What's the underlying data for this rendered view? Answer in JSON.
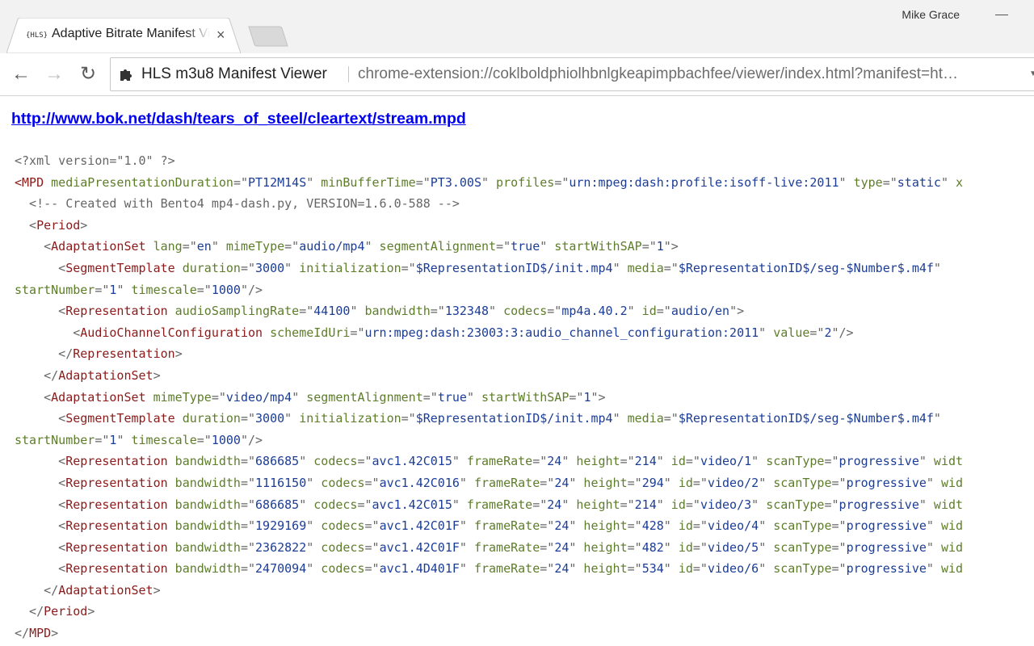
{
  "window": {
    "user_name": "Mike Grace"
  },
  "tab": {
    "favicon_text": "{HLS}",
    "title": "Adaptive Bitrate Manifest Viewer",
    "close_glyph": "×"
  },
  "toolbar": {
    "back_glyph": "←",
    "forward_glyph": "→",
    "reload_glyph": "↻",
    "extension_name": "HLS m3u8 Manifest Viewer",
    "url": "chrome-extension://coklboldphiolhbnlgkeapimpbachfee/viewer/index.html?manifest=ht…",
    "icons": [
      "back-arrow-icon",
      "forward-arrow-icon",
      "reload-icon",
      "puzzle-piece-icon",
      "dropdown-arrow-icon"
    ]
  },
  "page": {
    "manifest_url": "http://www.bok.net/dash/tears_of_steel/cleartext/stream.mpd"
  },
  "xml_lines": [
    [
      {
        "t": "c",
        "s": "<?xml version=\"1.0\" ?>"
      }
    ],
    [
      {
        "t": "t",
        "s": "<MPD"
      },
      {
        "t": "a",
        "s": " mediaPresentationDuration"
      },
      {
        "t": "p",
        "s": "=\""
      },
      {
        "t": "v",
        "s": "PT12M14S"
      },
      {
        "t": "p",
        "s": "\""
      },
      {
        "t": "a",
        "s": " minBufferTime"
      },
      {
        "t": "p",
        "s": "=\""
      },
      {
        "t": "v",
        "s": "PT3.00S"
      },
      {
        "t": "p",
        "s": "\""
      },
      {
        "t": "a",
        "s": " profiles"
      },
      {
        "t": "p",
        "s": "=\""
      },
      {
        "t": "v",
        "s": "urn:mpeg:dash:profile:isoff-live:2011"
      },
      {
        "t": "p",
        "s": "\""
      },
      {
        "t": "a",
        "s": " type"
      },
      {
        "t": "p",
        "s": "=\""
      },
      {
        "t": "v",
        "s": "static"
      },
      {
        "t": "p",
        "s": "\""
      },
      {
        "t": "a",
        "s": " x"
      }
    ],
    [
      {
        "t": "c",
        "s": "  <!-- Created with Bento4 mp4-dash.py, VERSION=1.6.0-588 -->"
      }
    ],
    [
      {
        "t": "p",
        "s": "  <"
      },
      {
        "t": "t",
        "s": "Period"
      },
      {
        "t": "p",
        "s": ">"
      }
    ],
    [
      {
        "t": "p",
        "s": "    <"
      },
      {
        "t": "t",
        "s": "AdaptationSet"
      },
      {
        "t": "a",
        "s": " lang"
      },
      {
        "t": "p",
        "s": "=\""
      },
      {
        "t": "v",
        "s": "en"
      },
      {
        "t": "p",
        "s": "\""
      },
      {
        "t": "a",
        "s": " mimeType"
      },
      {
        "t": "p",
        "s": "=\""
      },
      {
        "t": "v",
        "s": "audio/mp4"
      },
      {
        "t": "p",
        "s": "\""
      },
      {
        "t": "a",
        "s": " segmentAlignment"
      },
      {
        "t": "p",
        "s": "=\""
      },
      {
        "t": "v",
        "s": "true"
      },
      {
        "t": "p",
        "s": "\""
      },
      {
        "t": "a",
        "s": " startWithSAP"
      },
      {
        "t": "p",
        "s": "=\""
      },
      {
        "t": "v",
        "s": "1"
      },
      {
        "t": "p",
        "s": "\">"
      }
    ],
    [
      {
        "t": "p",
        "s": "      <"
      },
      {
        "t": "t",
        "s": "SegmentTemplate"
      },
      {
        "t": "a",
        "s": " duration"
      },
      {
        "t": "p",
        "s": "=\""
      },
      {
        "t": "v",
        "s": "3000"
      },
      {
        "t": "p",
        "s": "\""
      },
      {
        "t": "a",
        "s": " initialization"
      },
      {
        "t": "p",
        "s": "=\""
      },
      {
        "t": "v",
        "s": "$RepresentationID$/init.mp4"
      },
      {
        "t": "p",
        "s": "\""
      },
      {
        "t": "a",
        "s": " media"
      },
      {
        "t": "p",
        "s": "=\""
      },
      {
        "t": "v",
        "s": "$RepresentationID$/seg-$Number$.m4f"
      },
      {
        "t": "p",
        "s": "\""
      }
    ],
    [
      {
        "t": "a",
        "s": "startNumber"
      },
      {
        "t": "p",
        "s": "=\""
      },
      {
        "t": "v",
        "s": "1"
      },
      {
        "t": "p",
        "s": "\""
      },
      {
        "t": "a",
        "s": " timescale"
      },
      {
        "t": "p",
        "s": "=\""
      },
      {
        "t": "v",
        "s": "1000"
      },
      {
        "t": "p",
        "s": "\"/>"
      }
    ],
    [
      {
        "t": "p",
        "s": "      <"
      },
      {
        "t": "t",
        "s": "Representation"
      },
      {
        "t": "a",
        "s": " audioSamplingRate"
      },
      {
        "t": "p",
        "s": "=\""
      },
      {
        "t": "v",
        "s": "44100"
      },
      {
        "t": "p",
        "s": "\""
      },
      {
        "t": "a",
        "s": " bandwidth"
      },
      {
        "t": "p",
        "s": "=\""
      },
      {
        "t": "v",
        "s": "132348"
      },
      {
        "t": "p",
        "s": "\""
      },
      {
        "t": "a",
        "s": " codecs"
      },
      {
        "t": "p",
        "s": "=\""
      },
      {
        "t": "v",
        "s": "mp4a.40.2"
      },
      {
        "t": "p",
        "s": "\""
      },
      {
        "t": "a",
        "s": " id"
      },
      {
        "t": "p",
        "s": "=\""
      },
      {
        "t": "v",
        "s": "audio/en"
      },
      {
        "t": "p",
        "s": "\">"
      }
    ],
    [
      {
        "t": "p",
        "s": "        <"
      },
      {
        "t": "t",
        "s": "AudioChannelConfiguration"
      },
      {
        "t": "a",
        "s": " schemeIdUri"
      },
      {
        "t": "p",
        "s": "=\""
      },
      {
        "t": "v",
        "s": "urn:mpeg:dash:23003:3:audio_channel_configuration:2011"
      },
      {
        "t": "p",
        "s": "\""
      },
      {
        "t": "a",
        "s": " value"
      },
      {
        "t": "p",
        "s": "=\""
      },
      {
        "t": "v",
        "s": "2"
      },
      {
        "t": "p",
        "s": "\"/>"
      }
    ],
    [
      {
        "t": "p",
        "s": "      </"
      },
      {
        "t": "t",
        "s": "Representation"
      },
      {
        "t": "p",
        "s": ">"
      }
    ],
    [
      {
        "t": "p",
        "s": "    </"
      },
      {
        "t": "t",
        "s": "AdaptationSet"
      },
      {
        "t": "p",
        "s": ">"
      }
    ],
    [
      {
        "t": "p",
        "s": "    <"
      },
      {
        "t": "t",
        "s": "AdaptationSet"
      },
      {
        "t": "a",
        "s": " mimeType"
      },
      {
        "t": "p",
        "s": "=\""
      },
      {
        "t": "v",
        "s": "video/mp4"
      },
      {
        "t": "p",
        "s": "\""
      },
      {
        "t": "a",
        "s": " segmentAlignment"
      },
      {
        "t": "p",
        "s": "=\""
      },
      {
        "t": "v",
        "s": "true"
      },
      {
        "t": "p",
        "s": "\""
      },
      {
        "t": "a",
        "s": " startWithSAP"
      },
      {
        "t": "p",
        "s": "=\""
      },
      {
        "t": "v",
        "s": "1"
      },
      {
        "t": "p",
        "s": "\">"
      }
    ],
    [
      {
        "t": "p",
        "s": "      <"
      },
      {
        "t": "t",
        "s": "SegmentTemplate"
      },
      {
        "t": "a",
        "s": " duration"
      },
      {
        "t": "p",
        "s": "=\""
      },
      {
        "t": "v",
        "s": "3000"
      },
      {
        "t": "p",
        "s": "\""
      },
      {
        "t": "a",
        "s": " initialization"
      },
      {
        "t": "p",
        "s": "=\""
      },
      {
        "t": "v",
        "s": "$RepresentationID$/init.mp4"
      },
      {
        "t": "p",
        "s": "\""
      },
      {
        "t": "a",
        "s": " media"
      },
      {
        "t": "p",
        "s": "=\""
      },
      {
        "t": "v",
        "s": "$RepresentationID$/seg-$Number$.m4f"
      },
      {
        "t": "p",
        "s": "\""
      }
    ],
    [
      {
        "t": "a",
        "s": "startNumber"
      },
      {
        "t": "p",
        "s": "=\""
      },
      {
        "t": "v",
        "s": "1"
      },
      {
        "t": "p",
        "s": "\""
      },
      {
        "t": "a",
        "s": " timescale"
      },
      {
        "t": "p",
        "s": "=\""
      },
      {
        "t": "v",
        "s": "1000"
      },
      {
        "t": "p",
        "s": "\"/>"
      }
    ],
    [
      {
        "t": "p",
        "s": "      <"
      },
      {
        "t": "t",
        "s": "Representation"
      },
      {
        "t": "a",
        "s": " bandwidth"
      },
      {
        "t": "p",
        "s": "=\""
      },
      {
        "t": "v",
        "s": "686685"
      },
      {
        "t": "p",
        "s": "\""
      },
      {
        "t": "a",
        "s": " codecs"
      },
      {
        "t": "p",
        "s": "=\""
      },
      {
        "t": "v",
        "s": "avc1.42C015"
      },
      {
        "t": "p",
        "s": "\""
      },
      {
        "t": "a",
        "s": " frameRate"
      },
      {
        "t": "p",
        "s": "=\""
      },
      {
        "t": "v",
        "s": "24"
      },
      {
        "t": "p",
        "s": "\""
      },
      {
        "t": "a",
        "s": " height"
      },
      {
        "t": "p",
        "s": "=\""
      },
      {
        "t": "v",
        "s": "214"
      },
      {
        "t": "p",
        "s": "\""
      },
      {
        "t": "a",
        "s": " id"
      },
      {
        "t": "p",
        "s": "=\""
      },
      {
        "t": "v",
        "s": "video/1"
      },
      {
        "t": "p",
        "s": "\""
      },
      {
        "t": "a",
        "s": " scanType"
      },
      {
        "t": "p",
        "s": "=\""
      },
      {
        "t": "v",
        "s": "progressive"
      },
      {
        "t": "p",
        "s": "\""
      },
      {
        "t": "a",
        "s": " widt"
      }
    ],
    [
      {
        "t": "p",
        "s": "      <"
      },
      {
        "t": "t",
        "s": "Representation"
      },
      {
        "t": "a",
        "s": " bandwidth"
      },
      {
        "t": "p",
        "s": "=\""
      },
      {
        "t": "v",
        "s": "1116150"
      },
      {
        "t": "p",
        "s": "\""
      },
      {
        "t": "a",
        "s": " codecs"
      },
      {
        "t": "p",
        "s": "=\""
      },
      {
        "t": "v",
        "s": "avc1.42C016"
      },
      {
        "t": "p",
        "s": "\""
      },
      {
        "t": "a",
        "s": " frameRate"
      },
      {
        "t": "p",
        "s": "=\""
      },
      {
        "t": "v",
        "s": "24"
      },
      {
        "t": "p",
        "s": "\""
      },
      {
        "t": "a",
        "s": " height"
      },
      {
        "t": "p",
        "s": "=\""
      },
      {
        "t": "v",
        "s": "294"
      },
      {
        "t": "p",
        "s": "\""
      },
      {
        "t": "a",
        "s": " id"
      },
      {
        "t": "p",
        "s": "=\""
      },
      {
        "t": "v",
        "s": "video/2"
      },
      {
        "t": "p",
        "s": "\""
      },
      {
        "t": "a",
        "s": " scanType"
      },
      {
        "t": "p",
        "s": "=\""
      },
      {
        "t": "v",
        "s": "progressive"
      },
      {
        "t": "p",
        "s": "\""
      },
      {
        "t": "a",
        "s": " wid"
      }
    ],
    [
      {
        "t": "p",
        "s": "      <"
      },
      {
        "t": "t",
        "s": "Representation"
      },
      {
        "t": "a",
        "s": " bandwidth"
      },
      {
        "t": "p",
        "s": "=\""
      },
      {
        "t": "v",
        "s": "686685"
      },
      {
        "t": "p",
        "s": "\""
      },
      {
        "t": "a",
        "s": " codecs"
      },
      {
        "t": "p",
        "s": "=\""
      },
      {
        "t": "v",
        "s": "avc1.42C015"
      },
      {
        "t": "p",
        "s": "\""
      },
      {
        "t": "a",
        "s": " frameRate"
      },
      {
        "t": "p",
        "s": "=\""
      },
      {
        "t": "v",
        "s": "24"
      },
      {
        "t": "p",
        "s": "\""
      },
      {
        "t": "a",
        "s": " height"
      },
      {
        "t": "p",
        "s": "=\""
      },
      {
        "t": "v",
        "s": "214"
      },
      {
        "t": "p",
        "s": "\""
      },
      {
        "t": "a",
        "s": " id"
      },
      {
        "t": "p",
        "s": "=\""
      },
      {
        "t": "v",
        "s": "video/3"
      },
      {
        "t": "p",
        "s": "\""
      },
      {
        "t": "a",
        "s": " scanType"
      },
      {
        "t": "p",
        "s": "=\""
      },
      {
        "t": "v",
        "s": "progressive"
      },
      {
        "t": "p",
        "s": "\""
      },
      {
        "t": "a",
        "s": " widt"
      }
    ],
    [
      {
        "t": "p",
        "s": "      <"
      },
      {
        "t": "t",
        "s": "Representation"
      },
      {
        "t": "a",
        "s": " bandwidth"
      },
      {
        "t": "p",
        "s": "=\""
      },
      {
        "t": "v",
        "s": "1929169"
      },
      {
        "t": "p",
        "s": "\""
      },
      {
        "t": "a",
        "s": " codecs"
      },
      {
        "t": "p",
        "s": "=\""
      },
      {
        "t": "v",
        "s": "avc1.42C01F"
      },
      {
        "t": "p",
        "s": "\""
      },
      {
        "t": "a",
        "s": " frameRate"
      },
      {
        "t": "p",
        "s": "=\""
      },
      {
        "t": "v",
        "s": "24"
      },
      {
        "t": "p",
        "s": "\""
      },
      {
        "t": "a",
        "s": " height"
      },
      {
        "t": "p",
        "s": "=\""
      },
      {
        "t": "v",
        "s": "428"
      },
      {
        "t": "p",
        "s": "\""
      },
      {
        "t": "a",
        "s": " id"
      },
      {
        "t": "p",
        "s": "=\""
      },
      {
        "t": "v",
        "s": "video/4"
      },
      {
        "t": "p",
        "s": "\""
      },
      {
        "t": "a",
        "s": " scanType"
      },
      {
        "t": "p",
        "s": "=\""
      },
      {
        "t": "v",
        "s": "progressive"
      },
      {
        "t": "p",
        "s": "\""
      },
      {
        "t": "a",
        "s": " wid"
      }
    ],
    [
      {
        "t": "p",
        "s": "      <"
      },
      {
        "t": "t",
        "s": "Representation"
      },
      {
        "t": "a",
        "s": " bandwidth"
      },
      {
        "t": "p",
        "s": "=\""
      },
      {
        "t": "v",
        "s": "2362822"
      },
      {
        "t": "p",
        "s": "\""
      },
      {
        "t": "a",
        "s": " codecs"
      },
      {
        "t": "p",
        "s": "=\""
      },
      {
        "t": "v",
        "s": "avc1.42C01F"
      },
      {
        "t": "p",
        "s": "\""
      },
      {
        "t": "a",
        "s": " frameRate"
      },
      {
        "t": "p",
        "s": "=\""
      },
      {
        "t": "v",
        "s": "24"
      },
      {
        "t": "p",
        "s": "\""
      },
      {
        "t": "a",
        "s": " height"
      },
      {
        "t": "p",
        "s": "=\""
      },
      {
        "t": "v",
        "s": "482"
      },
      {
        "t": "p",
        "s": "\""
      },
      {
        "t": "a",
        "s": " id"
      },
      {
        "t": "p",
        "s": "=\""
      },
      {
        "t": "v",
        "s": "video/5"
      },
      {
        "t": "p",
        "s": "\""
      },
      {
        "t": "a",
        "s": " scanType"
      },
      {
        "t": "p",
        "s": "=\""
      },
      {
        "t": "v",
        "s": "progressive"
      },
      {
        "t": "p",
        "s": "\""
      },
      {
        "t": "a",
        "s": " wid"
      }
    ],
    [
      {
        "t": "p",
        "s": "      <"
      },
      {
        "t": "t",
        "s": "Representation"
      },
      {
        "t": "a",
        "s": " bandwidth"
      },
      {
        "t": "p",
        "s": "=\""
      },
      {
        "t": "v",
        "s": "2470094"
      },
      {
        "t": "p",
        "s": "\""
      },
      {
        "t": "a",
        "s": " codecs"
      },
      {
        "t": "p",
        "s": "=\""
      },
      {
        "t": "v",
        "s": "avc1.4D401F"
      },
      {
        "t": "p",
        "s": "\""
      },
      {
        "t": "a",
        "s": " frameRate"
      },
      {
        "t": "p",
        "s": "=\""
      },
      {
        "t": "v",
        "s": "24"
      },
      {
        "t": "p",
        "s": "\""
      },
      {
        "t": "a",
        "s": " height"
      },
      {
        "t": "p",
        "s": "=\""
      },
      {
        "t": "v",
        "s": "534"
      },
      {
        "t": "p",
        "s": "\""
      },
      {
        "t": "a",
        "s": " id"
      },
      {
        "t": "p",
        "s": "=\""
      },
      {
        "t": "v",
        "s": "video/6"
      },
      {
        "t": "p",
        "s": "\""
      },
      {
        "t": "a",
        "s": " scanType"
      },
      {
        "t": "p",
        "s": "=\""
      },
      {
        "t": "v",
        "s": "progressive"
      },
      {
        "t": "p",
        "s": "\""
      },
      {
        "t": "a",
        "s": " wid"
      }
    ],
    [
      {
        "t": "p",
        "s": "    </"
      },
      {
        "t": "t",
        "s": "AdaptationSet"
      },
      {
        "t": "p",
        "s": ">"
      }
    ],
    [
      {
        "t": "p",
        "s": "  </"
      },
      {
        "t": "t",
        "s": "Period"
      },
      {
        "t": "p",
        "s": ">"
      }
    ],
    [
      {
        "t": "p",
        "s": "</"
      },
      {
        "t": "t",
        "s": "MPD"
      },
      {
        "t": "p",
        "s": ">"
      }
    ]
  ],
  "colors": {
    "tag": "#8b1a1a",
    "attribute": "#5e7d2b",
    "value": "#1c3d96",
    "punctuation": "#666666",
    "link": "#0000ee"
  }
}
